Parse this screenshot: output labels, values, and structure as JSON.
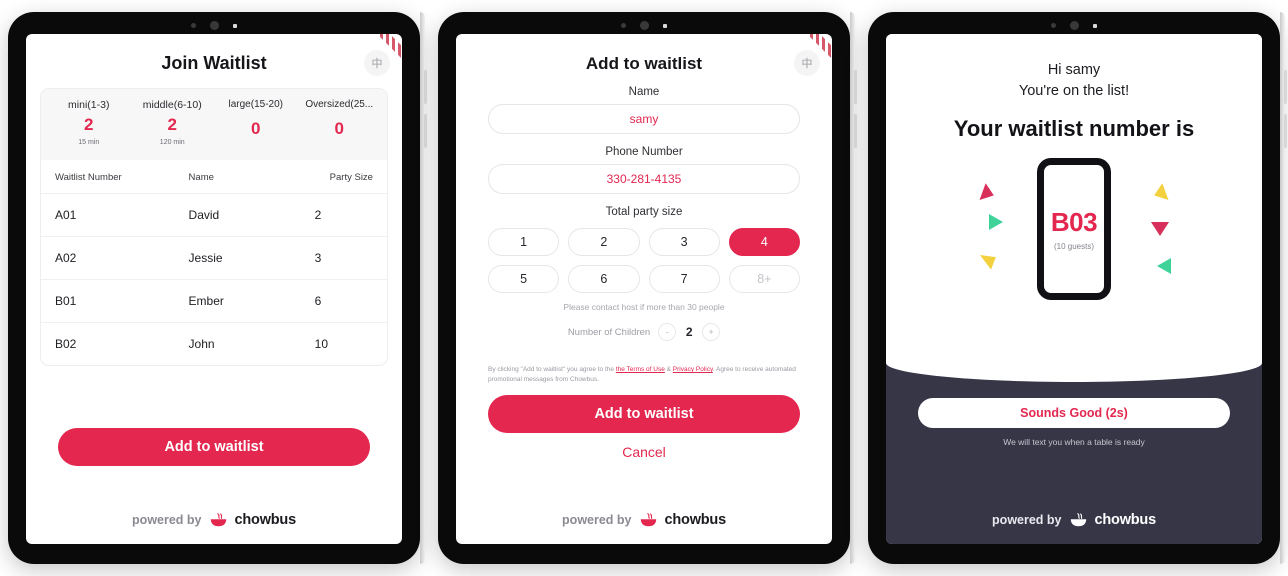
{
  "brand": {
    "powered_by": "powered by",
    "name": "chowbus",
    "accent": "#e3274f",
    "dark": "#363646"
  },
  "panel1": {
    "title": "Join Waitlist",
    "lang_button": "中",
    "stats": [
      {
        "label": "mini(1-3)",
        "value": "2",
        "sub": "15 min"
      },
      {
        "label": "middle(6-10)",
        "value": "2",
        "sub": "120 min"
      },
      {
        "label": "large(15-20)",
        "value": "0",
        "sub": ""
      },
      {
        "label": "Oversized(25...",
        "value": "0",
        "sub": ""
      }
    ],
    "table": {
      "columns": [
        "Waitlist Number",
        "Name",
        "Party Size"
      ],
      "rows": [
        {
          "number": "A01",
          "name": "David",
          "size": "2"
        },
        {
          "number": "A02",
          "name": "Jessie",
          "size": "3"
        },
        {
          "number": "B01",
          "name": "Ember",
          "size": "6"
        },
        {
          "number": "B02",
          "name": "John",
          "size": "10"
        }
      ]
    },
    "cta": "Add to waitlist"
  },
  "panel2": {
    "title": "Add to waitlist",
    "lang_button": "中",
    "name_label": "Name",
    "name_value": "samy",
    "phone_label": "Phone Number",
    "phone_value": "330-281-4135",
    "party_label": "Total party size",
    "party_options": [
      "1",
      "2",
      "3",
      "4",
      "5",
      "6",
      "7",
      "8+"
    ],
    "party_selected": "4",
    "party_disabled": "8+",
    "hint": "Please contact host if more than 30 people",
    "children_label": "Number of Children",
    "children_value": "2",
    "children_minus": "-",
    "children_plus": "+",
    "terms_prefix": "By clicking \"Add to waitlist\" you agree to the ",
    "terms_link1": "the Terms of Use",
    "terms_amp": " & ",
    "terms_link2": "Privacy Policy",
    "terms_suffix": ". Agree to receive automated promotional messages from Chowbus.",
    "cta": "Add to waitlist",
    "cancel": "Cancel"
  },
  "panel3": {
    "greeting": "Hi samy",
    "subgreeting": "You're on the list!",
    "headline": "Your waitlist number is",
    "waitlist_number": "B03",
    "guests": "(10 guests)",
    "confirm": "Sounds Good (2s)",
    "note": "We will text you when a table is ready",
    "confetti_colors": [
      "#e3274f",
      "#3fd39a",
      "#f5d547",
      "#f5d547",
      "#3fd39a",
      "#e3274f"
    ]
  }
}
